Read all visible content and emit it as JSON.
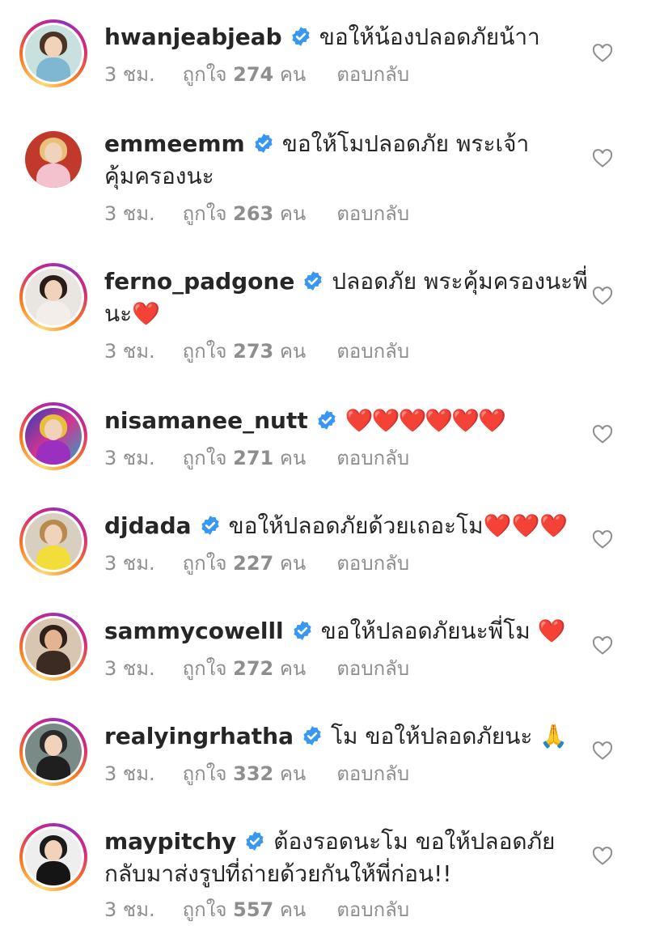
{
  "ui": {
    "reply_label": "ตอบกลับ",
    "likes_prefix": "ถูกใจ",
    "likes_suffix": "คน"
  },
  "colors": {
    "text": "#262626",
    "secondary": "#8e8e8e",
    "verified": "#3897f0",
    "heart_emoji": "#e0202e"
  },
  "comments": [
    {
      "username": "hwanjeabjeab",
      "verified": true,
      "text": "ขอให้น้องปลอดภัยน้าา",
      "text_cont": "",
      "time": "3 ชม.",
      "likes": "274",
      "avatar": "avatar-woman-beach"
    },
    {
      "username": "emmeemm",
      "verified": true,
      "text": "ขอให้โมปลอดภัย พระเจ้า",
      "text_cont": "คุ้มครองนะ",
      "time": "3 ชม.",
      "likes": "263",
      "avatar": "avatar-woman-blonde"
    },
    {
      "username": "ferno_padgone",
      "verified": true,
      "text": "ปลอดภัย พระคุ้มครองนะพี่",
      "text_cont": "นะ❤️",
      "time": "3 ชม.",
      "likes": "273",
      "avatar": "avatar-woman-dark-hair"
    },
    {
      "username": "nisamanee_nutt",
      "verified": true,
      "text": "❤️❤️❤️❤️❤️❤️",
      "text_cont": "",
      "time": "3 ชม.",
      "likes": "271",
      "avatar": "avatar-woman-colorful"
    },
    {
      "username": "djdada",
      "verified": true,
      "text": "ขอให้ปลอดภัยด้วยเถอะโม❤️❤️❤️",
      "text_cont": "",
      "time": "3 ชม.",
      "likes": "227",
      "avatar": "avatar-woman-sunglasses"
    },
    {
      "username": "sammycowelll",
      "verified": true,
      "text": "ขอให้ปลอดภัยนะพี่โม ❤️",
      "text_cont": "",
      "time": "3 ชม.",
      "likes": "272",
      "avatar": "avatar-woman-portrait"
    },
    {
      "username": "realyingrhatha",
      "verified": true,
      "text": "โม ขอให้ปลอดภัยนะ 🙏",
      "text_cont": "",
      "time": "3 ชม.",
      "likes": "332",
      "avatar": "avatar-woman-swimsuit"
    },
    {
      "username": "maypitchy",
      "verified": true,
      "text": "ต้องรอดนะโม ขอให้ปลอดภัย",
      "text_cont": "กลับมาส่งรูปที่ถ่ายด้วยกันให้พี่ก่อน!!",
      "time": "3 ชม.",
      "likes": "557",
      "avatar": "avatar-woman-black-outfit"
    }
  ]
}
